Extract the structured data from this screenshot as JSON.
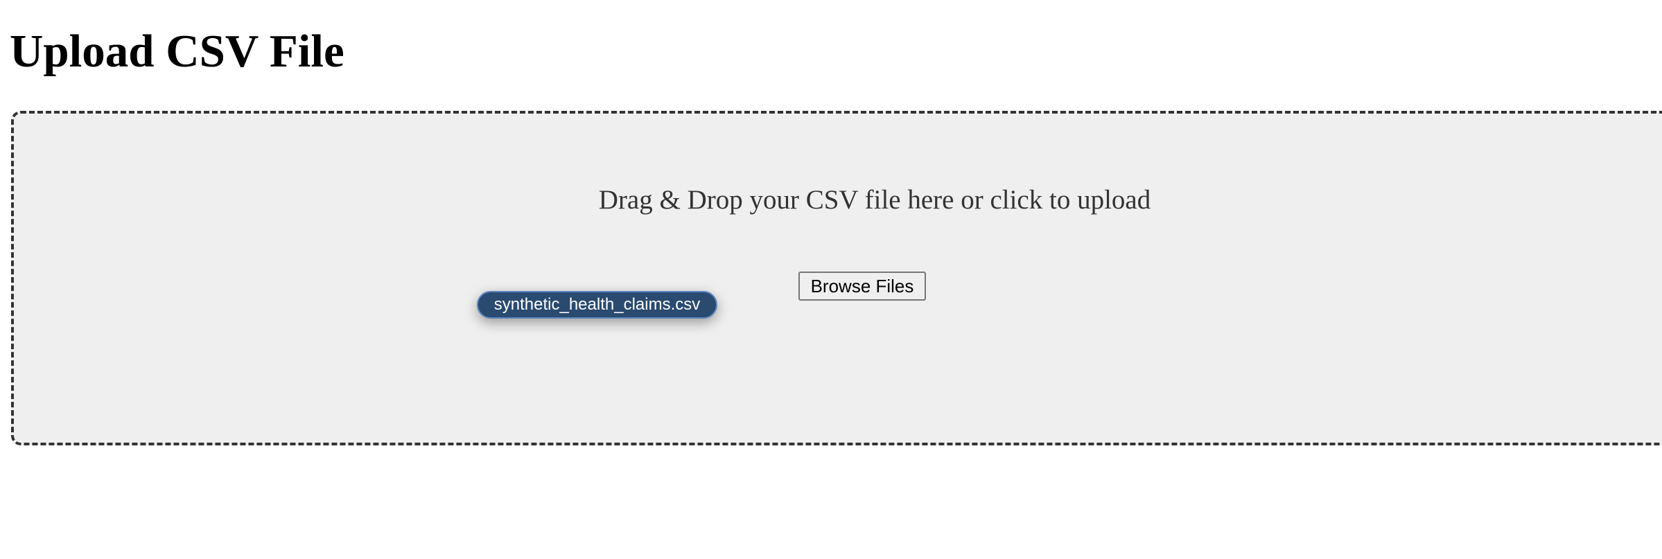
{
  "header": {
    "title": "Upload CSV File"
  },
  "upload_area": {
    "instructions": "Drag & Drop your CSV file here or click to upload",
    "browse_label": "Browse Files"
  },
  "dragged_file": {
    "name": "synthetic_health_claims.csv"
  },
  "colors": {
    "drop_zone_background": "#efefef",
    "drop_zone_border": "#333333",
    "file_chip_background": "#2a4a70",
    "file_chip_border": "#5b86bf"
  }
}
